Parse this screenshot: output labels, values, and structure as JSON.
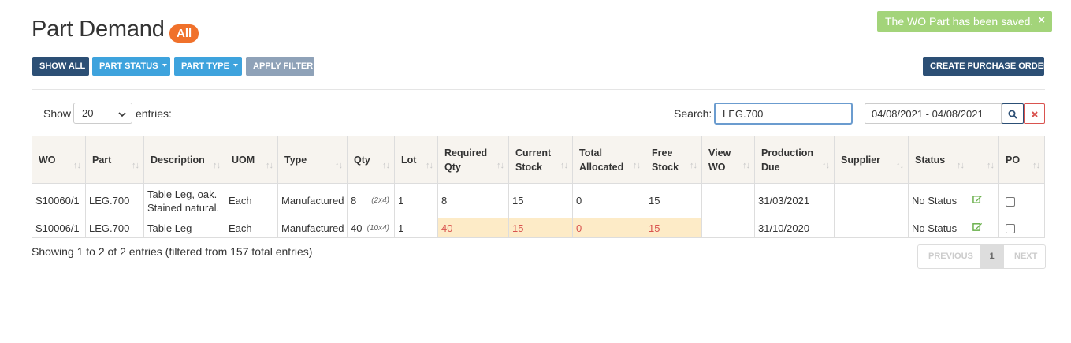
{
  "header": {
    "title": "Part Demand",
    "badge": "All"
  },
  "toast": {
    "message": "The WO Part has been saved.",
    "close": "×"
  },
  "toolbar": {
    "show_all": "SHOW ALL",
    "part_status": "PART STATUS",
    "part_type": "PART TYPE",
    "apply_filter": "APPLY FILTER",
    "create_po": "CREATE PURCHASE ORDER"
  },
  "controls": {
    "show_label": "Show",
    "page_size": "20",
    "entries_label": "entries:",
    "search_label": "Search:",
    "search_value": "LEG.700",
    "date_range": "04/08/2021 - 04/08/2021"
  },
  "table": {
    "columns": [
      "WO",
      "Part",
      "Description",
      "UOM",
      "Type",
      "Qty",
      "Lot",
      "Required Qty",
      "Current Stock",
      "Total Allocated",
      "Free Stock",
      "View WO",
      "Production Due",
      "Supplier",
      "Status",
      "",
      "PO"
    ],
    "rows": [
      {
        "wo": "S10060/1",
        "part": "LEG.700",
        "description": "Table Leg, oak. Stained natural.",
        "uom": "Each",
        "type": "Manufactured",
        "qty": "8",
        "qty_sub": "(2x4)",
        "lot": "1",
        "required_qty": "8",
        "current_stock": "15",
        "total_allocated": "0",
        "free_stock": "15",
        "view_wo": "",
        "production_due": "31/03/2021",
        "supplier": "",
        "status": "No Status"
      },
      {
        "wo": "S10006/1",
        "part": "LEG.700",
        "description": "Table Leg",
        "uom": "Each",
        "type": "Manufactured",
        "qty": "40",
        "qty_sub": "(10x4)",
        "lot": "1",
        "required_qty": "40",
        "current_stock": "15",
        "total_allocated": "0",
        "free_stock": "15",
        "view_wo": "",
        "production_due": "31/10/2020",
        "supplier": "",
        "status": "No Status"
      }
    ]
  },
  "footer": {
    "info": "Showing 1 to 2 of 2 entries (filtered from 157 total entries)"
  },
  "pagination": {
    "previous": "PREVIOUS",
    "current": "1",
    "next": "NEXT"
  },
  "colors": {
    "primary": "#2c4f75",
    "info": "#3ea3dd",
    "badge": "#f0712b",
    "toast": "#a3d47a",
    "highlight": "#fdebc7",
    "danger": "#d9534f"
  }
}
